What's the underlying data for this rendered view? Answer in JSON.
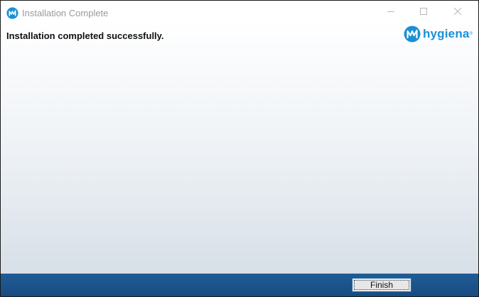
{
  "window": {
    "title": "Installation Complete",
    "controls": {
      "minimize_icon": "minimize-icon",
      "maximize_icon": "maximize-icon",
      "close_icon": "close-icon"
    }
  },
  "header": {
    "heading": "Installation completed successfully.",
    "brand": {
      "name": "hygiena",
      "registered_mark": "®",
      "color": "#1a8fd6"
    }
  },
  "footer": {
    "finish_label": "Finish",
    "color": "#1f5c95"
  },
  "icons": {
    "app_icon": "hygiena-logo-icon",
    "brand_mark": "hygiena-logo-icon"
  }
}
